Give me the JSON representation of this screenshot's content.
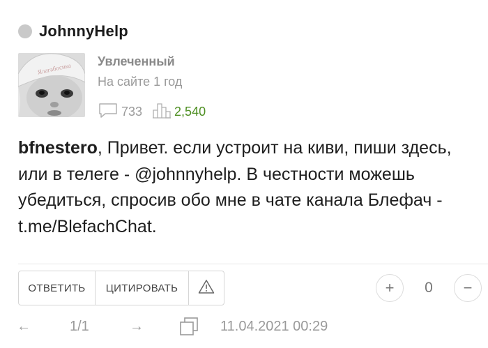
{
  "header": {
    "username": "JohnnyHelp"
  },
  "profile": {
    "rank": "Увлеченный",
    "on_site": "На сайте 1 год",
    "comments_count": "733",
    "rating": "2,540",
    "avatar_hat_text": "Ялагабосика"
  },
  "comment": {
    "mention": "bfnestero",
    "text": ", Привет. если устроит на киви, пиши здесь, или в телеге - @johnnyhelp. В честности можешь убедиться, спросив обо мне в чате канала Блефач - t.me/BlefachChat."
  },
  "actions": {
    "reply_label": "ОТВЕТИТЬ",
    "quote_label": "ЦИТИРОВАТЬ"
  },
  "vote": {
    "plus_label": "+",
    "score": "0",
    "minus_label": "−"
  },
  "footer": {
    "prev_arrow": "←",
    "pages": "1/1",
    "next_arrow": "→",
    "date": "11.04.2021 00:29"
  },
  "colors": {
    "rating_green": "#4e8f22",
    "muted_gray": "#9a9a9a"
  }
}
